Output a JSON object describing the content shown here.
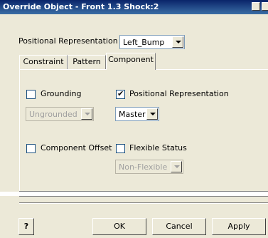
{
  "window": {
    "title": "Override Object - Front 1.3 Shock:2"
  },
  "top": {
    "label": "Positional Representation",
    "select_value": "Left_Bump"
  },
  "tabs": [
    {
      "label": "Constraint"
    },
    {
      "label": "Pattern"
    },
    {
      "label": "Component"
    }
  ],
  "component": {
    "grounding": {
      "label": "Grounding",
      "checked": false,
      "select_value": "Ungrounded",
      "select_enabled": false
    },
    "positional": {
      "label": "Positional Representation",
      "checked": true,
      "select_value": "Master",
      "select_enabled": true
    },
    "offset": {
      "label": "Component Offset",
      "checked": false
    },
    "flexible": {
      "label": "Flexible Status",
      "checked": false,
      "select_value": "Non-Flexible",
      "select_enabled": false
    }
  },
  "buttons": {
    "help": "?",
    "ok": "OK",
    "cancel": "Cancel",
    "apply": "Apply"
  },
  "colors": {
    "title_start": "#0a246a",
    "title_end": "#3a6ea5",
    "face": "#ece9d8"
  }
}
